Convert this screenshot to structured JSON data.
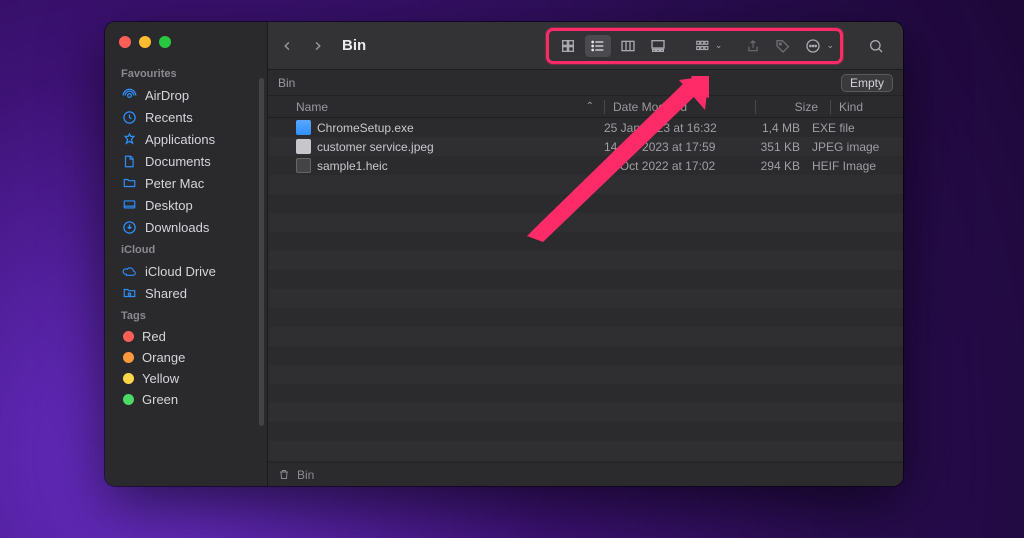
{
  "window": {
    "title": "Bin",
    "location_label": "Bin",
    "empty_button": "Empty",
    "pathbar": "Bin"
  },
  "sidebar": {
    "sections": [
      {
        "title": "Favourites",
        "items": [
          {
            "icon": "airdrop",
            "label": "AirDrop"
          },
          {
            "icon": "clock",
            "label": "Recents"
          },
          {
            "icon": "apps",
            "label": "Applications"
          },
          {
            "icon": "doc",
            "label": "Documents"
          },
          {
            "icon": "folder",
            "label": "Peter Mac"
          },
          {
            "icon": "desktop",
            "label": "Desktop"
          },
          {
            "icon": "download",
            "label": "Downloads"
          }
        ]
      },
      {
        "title": "iCloud",
        "items": [
          {
            "icon": "cloud",
            "label": "iCloud Drive"
          },
          {
            "icon": "shared",
            "label": "Shared"
          }
        ]
      },
      {
        "title": "Tags",
        "items": [
          {
            "color": "#ff5f57",
            "label": "Red"
          },
          {
            "color": "#ff9a3c",
            "label": "Orange"
          },
          {
            "color": "#ffd54a",
            "label": "Yellow"
          },
          {
            "color": "#4cd964",
            "label": "Green"
          }
        ]
      }
    ]
  },
  "columns": {
    "name": "Name",
    "date": "Date Modified",
    "size": "Size",
    "kind": "Kind"
  },
  "files": [
    {
      "name": "ChromeSetup.exe",
      "date": "25 Jan 2023 at 16:32",
      "size": "1,4 MB",
      "kind": "EXE file",
      "type": "exe"
    },
    {
      "name": "customer service.jpeg",
      "date": "14 Apr 2023 at 17:59",
      "size": "351 KB",
      "kind": "JPEG image",
      "type": "img"
    },
    {
      "name": "sample1.heic",
      "date": "11 Oct 2022 at 17:02",
      "size": "294 KB",
      "kind": "HEIF Image",
      "type": "heif"
    }
  ]
}
